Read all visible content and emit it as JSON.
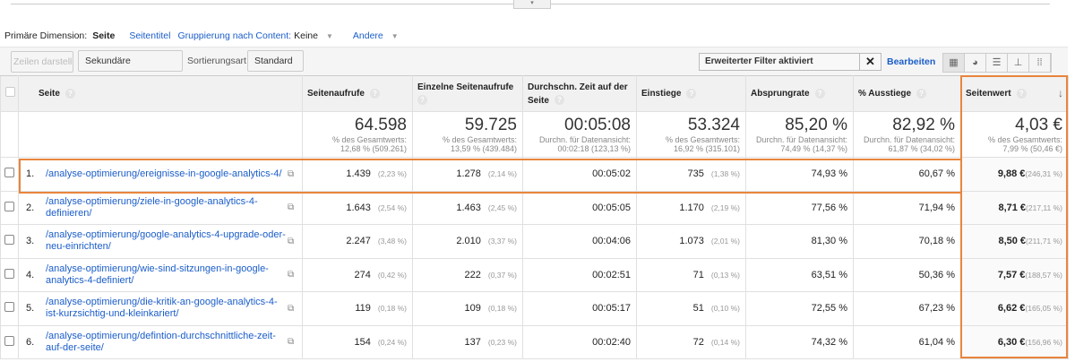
{
  "dimension_bar": {
    "label": "Primäre Dimension:",
    "selected": "Seite",
    "seitentitel": "Seitentitel",
    "gruppierung": "Gruppierung nach Content:",
    "gruppierung_value": "Keine",
    "andere": "Andere"
  },
  "toolbar": {
    "zeilen": "Zeilen darstellen",
    "sekundaer": "Sekundäre Dimension",
    "sortierung_label": "Sortierungsart:",
    "sortierung_value": "Standard",
    "filter": "Erweiterter Filter aktiviert",
    "bearbeiten": "Bearbeiten"
  },
  "columns": [
    "Seite",
    "Seitenaufrufe",
    "Einzelne Seitenaufrufe",
    "Durchschn. Zeit auf der Seite",
    "Einstiege",
    "Absprungrate",
    "% Ausstiege",
    "Seitenwert"
  ],
  "totals": [
    {
      "value": "64.598",
      "l1": "% des Gesamtwerts:",
      "l2": "12,68 % (509.261)"
    },
    {
      "value": "59.725",
      "l1": "% des Gesamtwerts:",
      "l2": "13,59 % (439.484)"
    },
    {
      "value": "00:05:08",
      "l1": "Durchn. für Datenansicht:",
      "l2": "00:02:18 (123,13 %)"
    },
    {
      "value": "53.324",
      "l1": "% des Gesamtwerts:",
      "l2": "16,92 % (315.101)"
    },
    {
      "value": "85,20 %",
      "l1": "Durchn. für Datenansicht:",
      "l2": "74,49 % (14,37 %)"
    },
    {
      "value": "82,92 %",
      "l1": "Durchn. für Datenansicht:",
      "l2": "61,87 % (34,02 %)"
    },
    {
      "value": "4,03 €",
      "l1": "% des Gesamtwerts:",
      "l2": "7,99 % (50,46 €)"
    }
  ],
  "rows": [
    {
      "n": "1.",
      "url": "/analyse-optimierung/ereignisse-in-google-analytics-4/",
      "pv": "1.439",
      "pvp": "(2,23 %)",
      "upv": "1.278",
      "upvp": "(2,14 %)",
      "time": "00:05:02",
      "ent": "735",
      "entp": "(1,38 %)",
      "bounce": "74,93 %",
      "exit": "60,67 %",
      "val": "9,88 €",
      "valp": "(246,31 %)"
    },
    {
      "n": "2.",
      "url": "/analyse-optimierung/ziele-in-google-analytics-4-definieren/",
      "pv": "1.643",
      "pvp": "(2,54 %)",
      "upv": "1.463",
      "upvp": "(2,45 %)",
      "time": "00:05:05",
      "ent": "1.170",
      "entp": "(2,19 %)",
      "bounce": "77,56 %",
      "exit": "71,94 %",
      "val": "8,71 €",
      "valp": "(217,11 %)"
    },
    {
      "n": "3.",
      "url": "/analyse-optimierung/google-analytics-4-upgrade-oder-neu-einrichten/",
      "pv": "2.247",
      "pvp": "(3,48 %)",
      "upv": "2.010",
      "upvp": "(3,37 %)",
      "time": "00:04:06",
      "ent": "1.073",
      "entp": "(2,01 %)",
      "bounce": "81,30 %",
      "exit": "70,18 %",
      "val": "8,50 €",
      "valp": "(211,71 %)"
    },
    {
      "n": "4.",
      "url": "/analyse-optimierung/wie-sind-sitzungen-in-google-analytics-4-definiert/",
      "pv": "274",
      "pvp": "(0,42 %)",
      "upv": "222",
      "upvp": "(0,37 %)",
      "time": "00:02:51",
      "ent": "71",
      "entp": "(0,13 %)",
      "bounce": "63,51 %",
      "exit": "50,36 %",
      "val": "7,57 €",
      "valp": "(188,57 %)"
    },
    {
      "n": "5.",
      "url": "/analyse-optimierung/die-kritik-an-google-analytics-4-ist-kurzsichtig-und-kleinkariert/",
      "pv": "119",
      "pvp": "(0,18 %)",
      "upv": "109",
      "upvp": "(0,18 %)",
      "time": "00:05:17",
      "ent": "51",
      "entp": "(0,10 %)",
      "bounce": "72,55 %",
      "exit": "67,23 %",
      "val": "6,62 €",
      "valp": "(165,05 %)"
    },
    {
      "n": "6.",
      "url": "/analyse-optimierung/defintion-durchschnittliche-zeit-auf-der-seite/",
      "pv": "154",
      "pvp": "(0,24 %)",
      "upv": "137",
      "upvp": "(0,23 %)",
      "time": "00:02:40",
      "ent": "72",
      "entp": "(0,14 %)",
      "bounce": "74,32 %",
      "exit": "61,04 %",
      "val": "6,30 €",
      "valp": "(156,96 %)"
    }
  ],
  "colors": {
    "link": "#1a5dc9",
    "highlight": "#e8853d"
  }
}
